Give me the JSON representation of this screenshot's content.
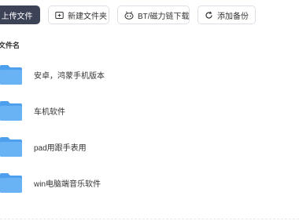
{
  "toolbar": {
    "upload_label": "上传文件",
    "new_folder_label": "新建文件夹",
    "bt_download_label": "BT/磁力链下载",
    "add_backup_label": "添加备份"
  },
  "list": {
    "column_header": "文件名",
    "items": [
      {
        "name": "安卓，鸿蒙手机版本"
      },
      {
        "name": "车机软件"
      },
      {
        "name": "pad用跟手表用"
      },
      {
        "name": "win电脑端音乐软件"
      }
    ]
  },
  "colors": {
    "primary_button": "#3d4356",
    "folder": "#5aa9f2"
  }
}
